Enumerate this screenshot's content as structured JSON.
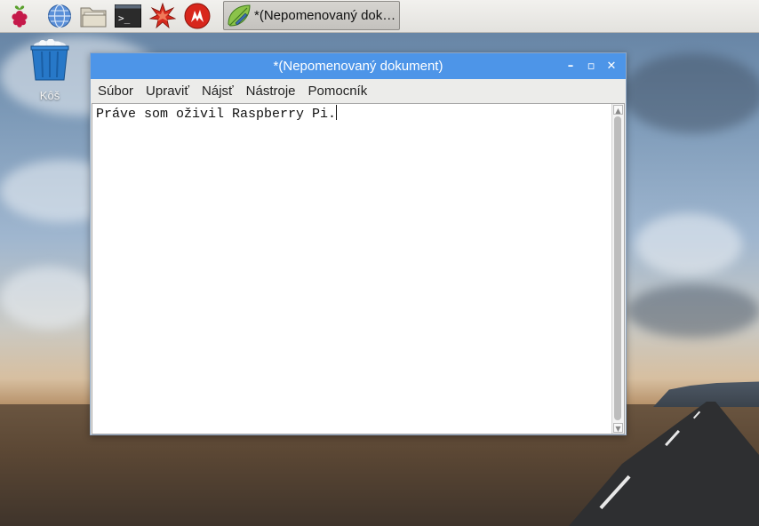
{
  "taskbar": {
    "launchers": [
      {
        "icon": "raspberry-icon"
      },
      {
        "icon": "web-browser-icon"
      },
      {
        "icon": "file-manager-icon"
      },
      {
        "icon": "terminal-icon"
      },
      {
        "icon": "mathematica-icon"
      },
      {
        "icon": "wolfram-icon"
      }
    ],
    "active_task": {
      "icon": "text-editor-leaf-icon",
      "label": "*(Nepomenovaný dok…"
    }
  },
  "desktop": {
    "trash": {
      "label": "Kôš",
      "icon": "trash-can-icon"
    }
  },
  "window": {
    "title": "*(Nepomenovaný dokument)",
    "buttons": {
      "minimize": "–",
      "maximize": "▫",
      "close": "✕"
    },
    "menu": [
      "Súbor",
      "Upraviť",
      "Nájsť",
      "Nástroje",
      "Pomocník"
    ],
    "content": "Práve som oživil Raspberry Pi."
  },
  "colors": {
    "titlebar": "#4d95e8",
    "taskbar": "#e8e7e3"
  }
}
